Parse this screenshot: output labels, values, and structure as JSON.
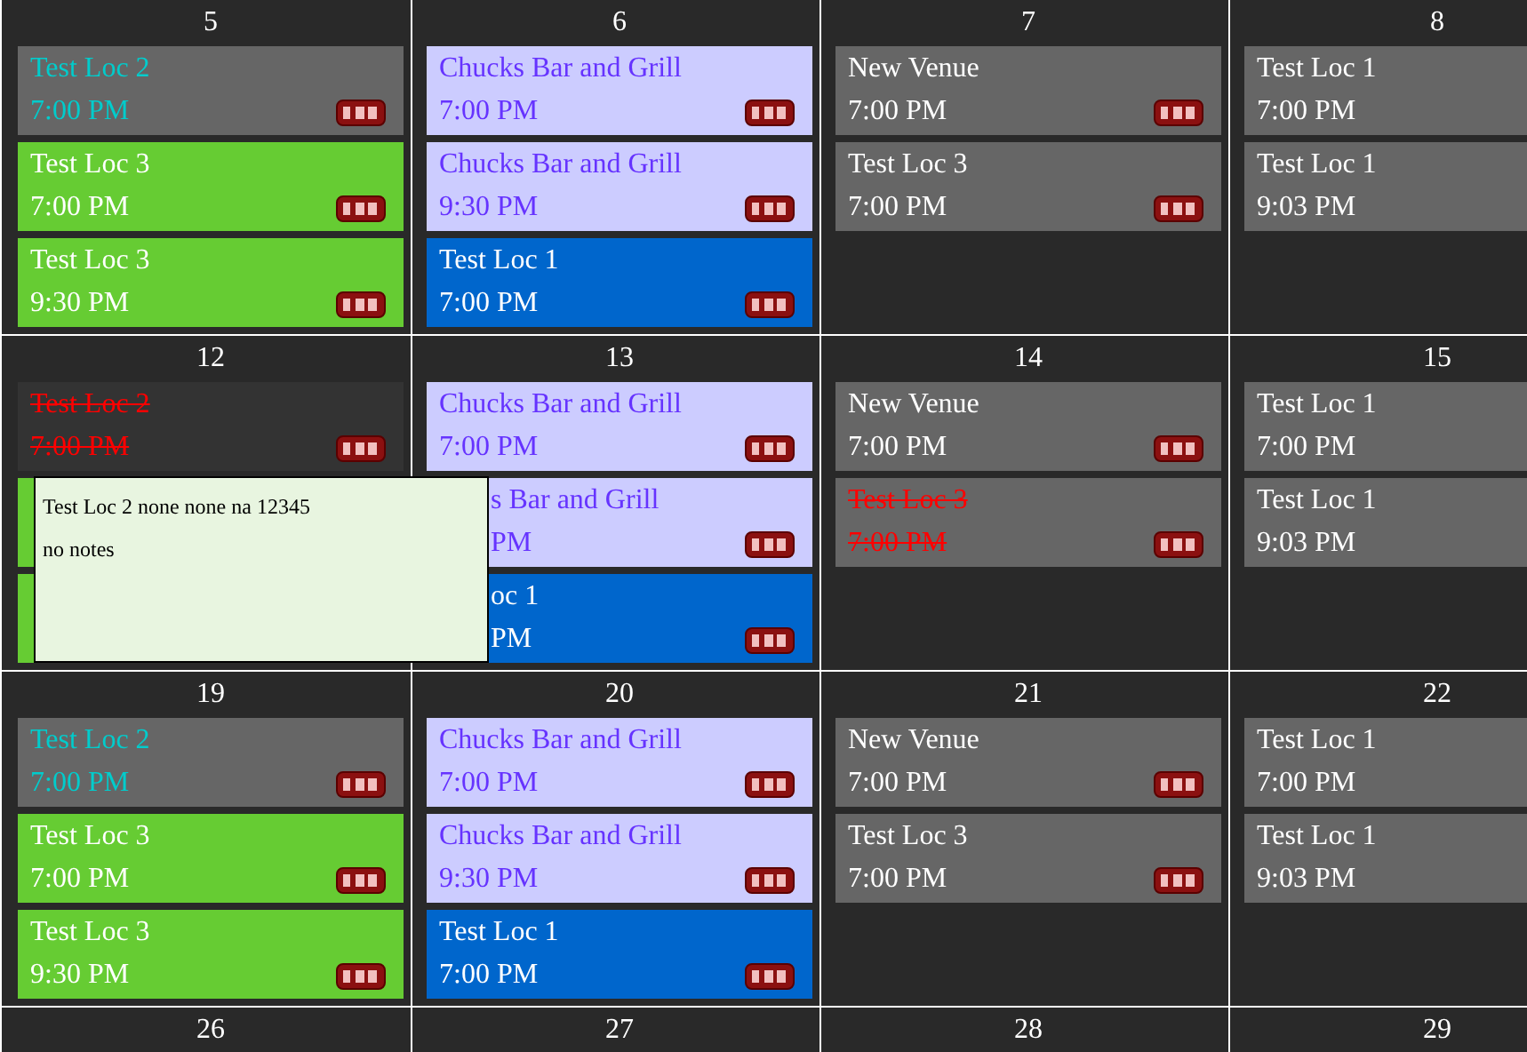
{
  "weeks": [
    {
      "days": [
        {
          "date": "5",
          "events": [
            {
              "title": "Test Loc 2",
              "time": "7:00 PM",
              "web": true,
              "cancelled": false,
              "color": "#666666",
              "kind": "featured"
            },
            {
              "title": "Test Loc 3",
              "time": "7:00 PM",
              "web": true,
              "cancelled": false,
              "color": "#66cc33",
              "kind": "standard"
            },
            {
              "title": "Test Loc 3",
              "time": "9:30 PM",
              "web": true,
              "cancelled": false,
              "color": "#66cc33",
              "kind": "standard"
            }
          ]
        },
        {
          "date": "6",
          "events": [
            {
              "title": "Chucks Bar and Grill",
              "time": "7:00 PM",
              "web": true,
              "cancelled": false,
              "color": "#ccccff",
              "kind": "partner"
            },
            {
              "title": "Chucks Bar and Grill",
              "time": "9:30 PM",
              "web": true,
              "cancelled": false,
              "color": "#ccccff",
              "kind": "partner"
            },
            {
              "title": "Test Loc 1",
              "time": "7:00 PM",
              "web": true,
              "cancelled": false,
              "color": "#0066cc",
              "kind": "standard"
            }
          ]
        },
        {
          "date": "7",
          "events": [
            {
              "title": "New Venue",
              "time": "7:00 PM",
              "web": true,
              "cancelled": false,
              "color": "#666666",
              "kind": "standard"
            },
            {
              "title": "Test Loc 3",
              "time": "7:00 PM",
              "web": true,
              "cancelled": false,
              "color": "#666666",
              "kind": "standard"
            }
          ]
        },
        {
          "date": "8",
          "events": [
            {
              "title": "Test Loc 1",
              "time": "7:00 PM",
              "cancelled": false,
              "color": "#666666",
              "kind": "standard"
            },
            {
              "title": "Test Loc 1",
              "time": "9:03 PM",
              "cancelled": false,
              "color": "#666666",
              "kind": "standard"
            }
          ]
        }
      ]
    },
    {
      "days": [
        {
          "date": "12",
          "events": [
            {
              "title": "Test Loc 2",
              "time": "7:00 PM",
              "web": true,
              "cancelled": true,
              "color": "#333333"
            },
            {
              "color": "#66cc33"
            },
            {
              "color": "#66cc33"
            }
          ]
        },
        {
          "date": "13",
          "events": [
            {
              "title": "Chucks Bar and Grill",
              "time": "7:00 PM",
              "web": true,
              "cancelled": false,
              "color": "#ccccff",
              "kind": "partner"
            },
            {
              "title": "s Bar and Grill",
              "time": "PM",
              "web": true,
              "cancelled": false,
              "covered": true,
              "color": "#ccccff",
              "kind": "partner"
            },
            {
              "title": "oc 1",
              "time": "PM",
              "web": true,
              "cancelled": false,
              "covered": true,
              "color": "#0066cc",
              "kind": "standard"
            }
          ]
        },
        {
          "date": "14",
          "events": [
            {
              "title": "New Venue",
              "time": "7:00 PM",
              "web": true,
              "cancelled": false,
              "color": "#666666",
              "kind": "standard"
            },
            {
              "title": "Test Loc 3",
              "time": "7:00 PM",
              "web": true,
              "cancelled": true,
              "color": "#666666"
            }
          ]
        },
        {
          "date": "15",
          "events": [
            {
              "title": "Test Loc 1",
              "time": "7:00 PM",
              "cancelled": false,
              "color": "#666666",
              "kind": "standard"
            },
            {
              "title": "Test Loc 1",
              "time": "9:03 PM",
              "cancelled": false,
              "color": "#666666",
              "kind": "standard"
            }
          ]
        }
      ]
    },
    {
      "days": [
        {
          "date": "19",
          "events": [
            {
              "title": "Test Loc 2",
              "time": "7:00 PM",
              "web": true,
              "cancelled": false,
              "color": "#666666",
              "kind": "featured"
            },
            {
              "title": "Test Loc 3",
              "time": "7:00 PM",
              "web": true,
              "cancelled": false,
              "color": "#66cc33",
              "kind": "standard"
            },
            {
              "title": "Test Loc 3",
              "time": "9:30 PM",
              "web": true,
              "cancelled": false,
              "color": "#66cc33",
              "kind": "standard"
            }
          ]
        },
        {
          "date": "20",
          "events": [
            {
              "title": "Chucks Bar and Grill",
              "time": "7:00 PM",
              "web": true,
              "cancelled": false,
              "color": "#ccccff",
              "kind": "partner"
            },
            {
              "title": "Chucks Bar and Grill",
              "time": "9:30 PM",
              "web": true,
              "cancelled": false,
              "color": "#ccccff",
              "kind": "partner"
            },
            {
              "title": "Test Loc 1",
              "time": "7:00 PM",
              "web": true,
              "cancelled": false,
              "color": "#0066cc",
              "kind": "standard"
            }
          ]
        },
        {
          "date": "21",
          "events": [
            {
              "title": "New Venue",
              "time": "7:00 PM",
              "web": true,
              "cancelled": false,
              "color": "#666666",
              "kind": "standard"
            },
            {
              "title": "Test Loc 3",
              "time": "7:00 PM",
              "web": true,
              "cancelled": false,
              "color": "#666666",
              "kind": "standard"
            }
          ]
        },
        {
          "date": "22",
          "events": [
            {
              "title": "Test Loc 1",
              "time": "7:00 PM",
              "cancelled": false,
              "color": "#666666",
              "kind": "standard"
            },
            {
              "title": "Test Loc 1",
              "time": "9:03 PM",
              "cancelled": false,
              "color": "#666666",
              "kind": "standard"
            }
          ]
        }
      ]
    },
    {
      "days": [
        {
          "date": "26"
        },
        {
          "date": "27"
        },
        {
          "date": "28"
        },
        {
          "date": "29"
        }
      ]
    }
  ],
  "tooltip": {
    "lines": [
      "Test Loc 2 none none na 12345",
      "no notes"
    ]
  }
}
